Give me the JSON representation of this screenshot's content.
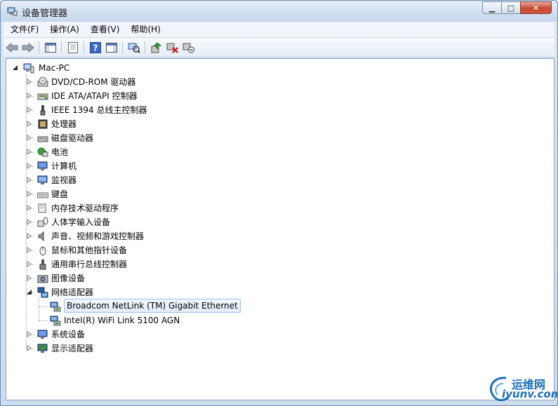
{
  "window": {
    "title": "设备管理器",
    "min_symbol": "▁",
    "max_symbol": "□",
    "close_symbol": "✕"
  },
  "menu": [
    "文件(F)",
    "操作(A)",
    "查看(V)",
    "帮助(H)"
  ],
  "toolbar": {
    "buttons": [
      "back-icon",
      "forward-icon",
      "console-tree-icon",
      "properties-icon",
      "help-icon",
      "action-pane-icon",
      "scan-hardware-icon",
      "update-driver-icon",
      "uninstall-icon",
      "disable-icon"
    ]
  },
  "tree": {
    "root": "Mac-PC",
    "categories": [
      {
        "label": "DVD/CD-ROM 驱动器",
        "icon": "dvd-icon"
      },
      {
        "label": "IDE ATA/ATAPI 控制器",
        "icon": "ide-controller-icon"
      },
      {
        "label": "IEEE 1394 总线主控制器",
        "icon": "ieee1394-icon"
      },
      {
        "label": "处理器",
        "icon": "processor-icon"
      },
      {
        "label": "磁盘驱动器",
        "icon": "disk-drive-icon"
      },
      {
        "label": "电池",
        "icon": "battery-icon"
      },
      {
        "label": "计算机",
        "icon": "computer-icon"
      },
      {
        "label": "监视器",
        "icon": "monitor-icon"
      },
      {
        "label": "键盘",
        "icon": "keyboard-icon"
      },
      {
        "label": "内存技术驱动程序",
        "icon": "memory-tech-icon"
      },
      {
        "label": "人体学输入设备",
        "icon": "hid-icon"
      },
      {
        "label": "声音、视频和游戏控制器",
        "icon": "sound-icon"
      },
      {
        "label": "鼠标和其他指针设备",
        "icon": "mouse-icon"
      },
      {
        "label": "通用串行总线控制器",
        "icon": "usb-icon"
      },
      {
        "label": "图像设备",
        "icon": "imaging-icon"
      },
      {
        "label": "网络适配器",
        "icon": "network-adapter-icon",
        "expanded": true,
        "children": [
          {
            "label": "Broadcom NetLink (TM) Gigabit Ethernet",
            "selected": true
          },
          {
            "label": "Intel(R) WiFi Link 5100 AGN"
          }
        ]
      },
      {
        "label": "系统设备",
        "icon": "system-devices-icon"
      },
      {
        "label": "显示适配器",
        "icon": "display-adapter-icon"
      }
    ]
  },
  "watermark": {
    "line1": "运维网",
    "line2": "iyunv.com"
  }
}
